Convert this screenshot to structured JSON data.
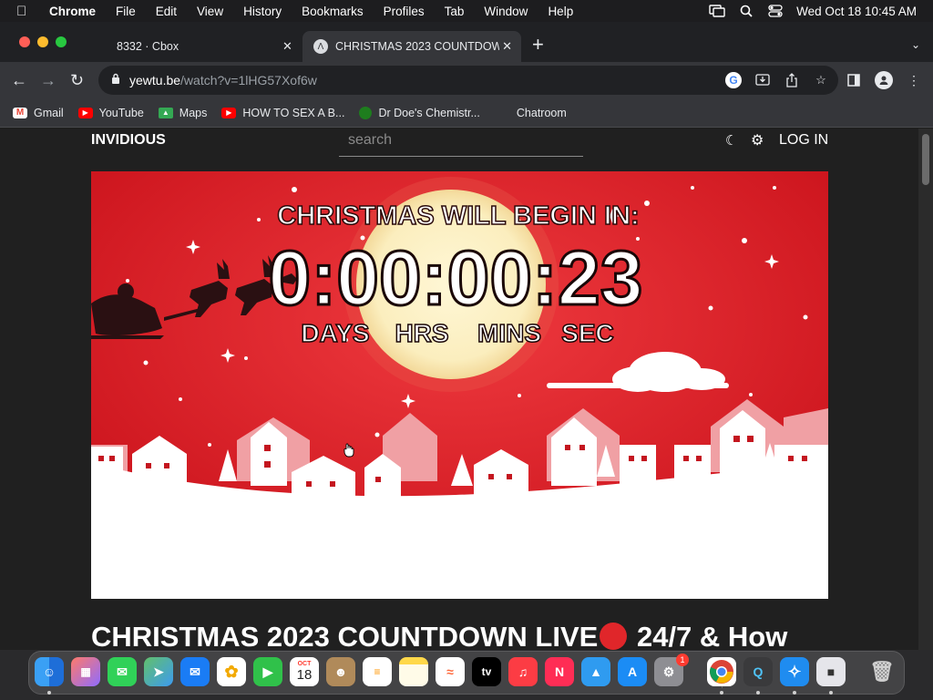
{
  "menubar": {
    "app": "Chrome",
    "items": [
      "File",
      "Edit",
      "View",
      "History",
      "Bookmarks",
      "Profiles",
      "Tab",
      "Window",
      "Help"
    ],
    "datetime": "Wed Oct 18  10:45 AM"
  },
  "tabs": [
    {
      "title": "8332 · Cbox",
      "active": false
    },
    {
      "title": "CHRISTMAS 2023 COUNTDOWN",
      "active": true
    }
  ],
  "toolbar": {
    "url_host": "yewtu.be",
    "url_path": "/watch?v=1lHG57Xof6w"
  },
  "bookmarks": [
    {
      "label": "Gmail",
      "icon": "gmail-icon"
    },
    {
      "label": "YouTube",
      "icon": "youtube-icon"
    },
    {
      "label": "Maps",
      "icon": "maps-icon"
    },
    {
      "label": "HOW TO SEX A B...",
      "icon": "youtube-icon"
    },
    {
      "label": "Dr Doe's Chemistr...",
      "icon": "site-icon"
    },
    {
      "label": "Chatroom",
      "icon": ""
    }
  ],
  "site": {
    "logo": "INVIDIOUS",
    "search_placeholder": "search",
    "login": "LOG IN"
  },
  "video": {
    "heading": "CHRISTMAS WILL BEGIN IN:",
    "timer": "0:00:00:23",
    "units": [
      "DAYS",
      "HRS",
      "MINS",
      "SEC"
    ],
    "title_before": "CHRISTMAS 2023 COUNTDOWN LIVE",
    "title_after": " 24/7 & How"
  },
  "dock": {
    "calendar_month": "OCT",
    "calendar_day": "18",
    "settings_badge": "1",
    "tv_label": "tv"
  },
  "colors": {
    "video_red": "#d8161f",
    "moon": "#fbf1c8",
    "page_bg": "#202020"
  }
}
